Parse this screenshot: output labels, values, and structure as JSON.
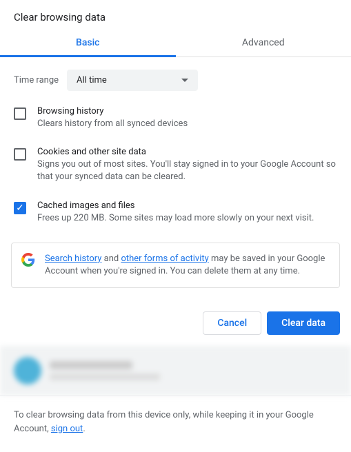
{
  "title": "Clear browsing data",
  "tabs": {
    "basic": "Basic",
    "advanced": "Advanced"
  },
  "time_range": {
    "label": "Time range",
    "value": "All time"
  },
  "options": {
    "browsing": {
      "title": "Browsing history",
      "desc": "Clears history from all synced devices",
      "checked": false
    },
    "cookies": {
      "title": "Cookies and other site data",
      "desc": "Signs you out of most sites. You'll stay signed in to your Google Account so that your synced data can be cleared.",
      "checked": false
    },
    "cache": {
      "title": "Cached images and files",
      "desc": "Frees up 220 MB. Some sites may load more slowly on your next visit.",
      "checked": true
    }
  },
  "info": {
    "link1": "Search history",
    "mid1": " and ",
    "link2": "other forms of activity",
    "rest": " may be saved in your Google Account when you're signed in. You can delete them at any time."
  },
  "buttons": {
    "cancel": "Cancel",
    "clear": "Clear data"
  },
  "footer": {
    "pre": "To clear browsing data from this device only, while keeping it in your Google Account, ",
    "link": "sign out",
    "post": "."
  }
}
